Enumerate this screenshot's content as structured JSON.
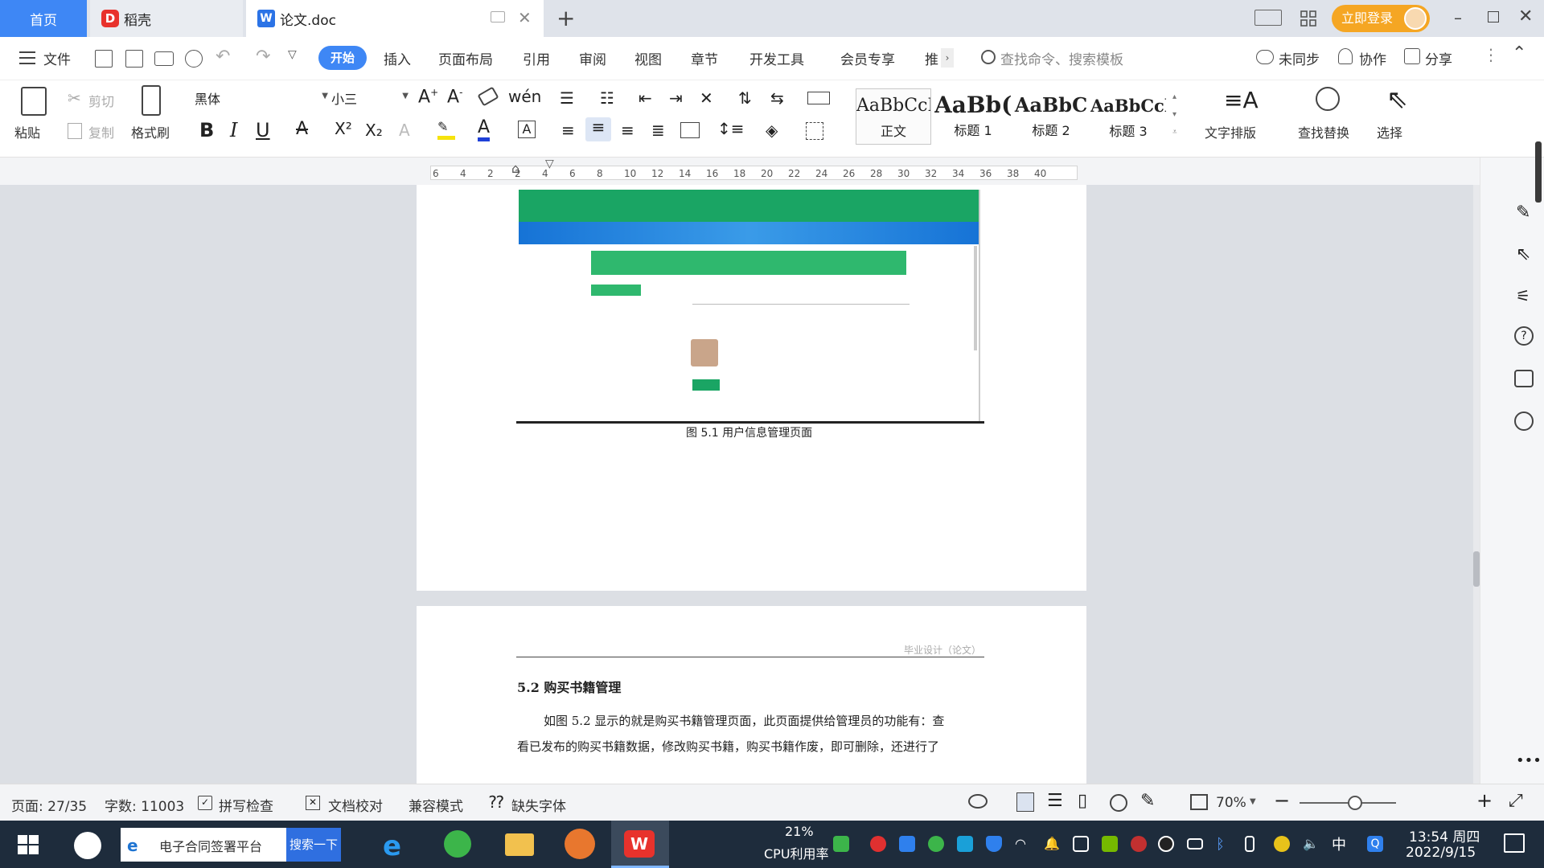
{
  "titlebar": {
    "tab_home": "首页",
    "tab_daoke": "稻壳",
    "tab_doc": "论文.doc",
    "login_label": "立即登录"
  },
  "menubar": {
    "file": "文件",
    "items": [
      "开始",
      "插入",
      "页面布局",
      "引用",
      "审阅",
      "视图",
      "章节",
      "开发工具",
      "会员专享",
      "推"
    ],
    "search_placeholder": "查找命令、搜索模板",
    "sync": "未同步",
    "collab": "协作",
    "share": "分享"
  },
  "ribbon": {
    "paste": "粘贴",
    "cut": "剪切",
    "copy": "复制",
    "format_painter": "格式刷",
    "font_name": "黑体",
    "font_size": "小三",
    "styles": [
      {
        "sample": "AaBbCcI",
        "label": "正文"
      },
      {
        "sample": "AaBb(",
        "label": "标题 1"
      },
      {
        "sample": "AaBbC",
        "label": "标题 2"
      },
      {
        "sample": "AaBbCcl",
        "label": "标题 3"
      }
    ],
    "text_layout": "文字排版",
    "find_replace": "查找替换",
    "select": "选择"
  },
  "ruler": {
    "ticks": [
      "6",
      "4",
      "2",
      "2",
      "4",
      "6",
      "8",
      "10",
      "12",
      "14",
      "16",
      "18",
      "20",
      "22",
      "24",
      "26",
      "28",
      "30",
      "32",
      "34",
      "36",
      "38",
      "40"
    ]
  },
  "document": {
    "figure_caption": "图 5.1  用户信息管理页面",
    "header_text": "毕业设计（论文）",
    "section_heading": "5.2  购买书籍管理",
    "para_line1": "如图 5.2 显示的就是购买书籍管理页面，此页面提供给管理员的功能有：查",
    "para_line2": "看已发布的购买书籍数据，修改购买书籍，购买书籍作废，即可删除，还进行了"
  },
  "statusbar": {
    "page": "页面: 27/35",
    "words": "字数: 11003",
    "spell": "拼写检查",
    "proof": "文档校对",
    "compat": "兼容模式",
    "missing_font": "缺失字体",
    "zoom": "70%"
  },
  "taskbar": {
    "search_text": "电子合同签署平台",
    "search_btn": "搜索一下",
    "cpu_pct": "21%",
    "cpu_label": "CPU利用率",
    "ime": "中",
    "time": "13:54 周四",
    "date": "2022/9/15"
  },
  "colors": {
    "accent": "#3e87f5",
    "login": "#f5a623",
    "doc_green": "#1aa564",
    "taskbar": "#1e2c3c"
  }
}
